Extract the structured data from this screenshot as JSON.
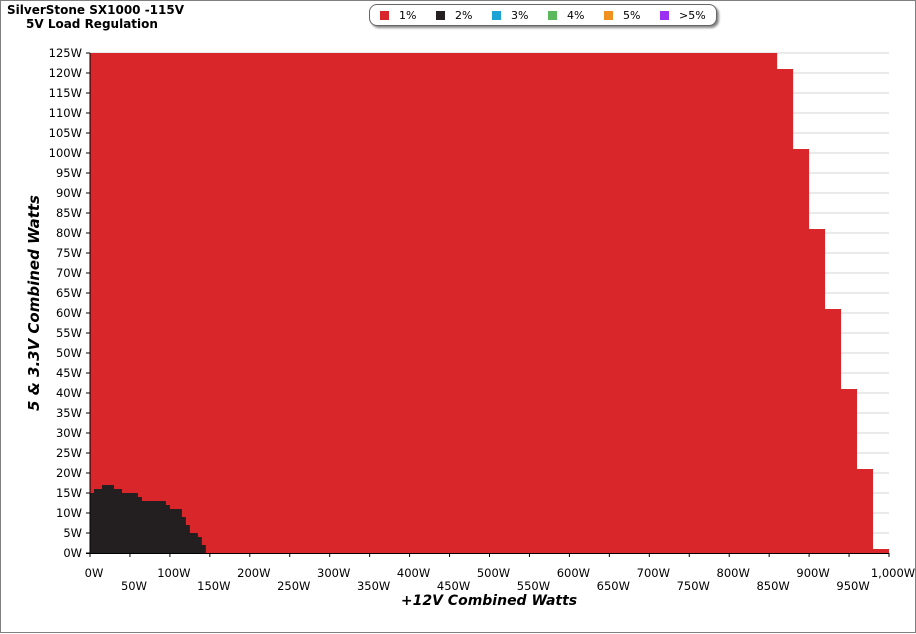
{
  "header": {
    "title": "SilverStone SX1000 -115V",
    "subtitle": "5V Load Regulation"
  },
  "legend": [
    {
      "label": "1%",
      "color": "#d9262b"
    },
    {
      "label": "2%",
      "color": "#231f20"
    },
    {
      "label": "3%",
      "color": "#1aa3d4"
    },
    {
      "label": "4%",
      "color": "#5cb85c"
    },
    {
      "label": "5%",
      "color": "#f0901e"
    },
    {
      "label": ">5%",
      "color": "#9b30f2"
    }
  ],
  "chart_data": {
    "type": "area",
    "xlabel": "+12V Combined Watts",
    "ylabel": "5 & 3.3V Combined Watts",
    "xlim": [
      0,
      1000
    ],
    "ylim": [
      0,
      125
    ],
    "x_ticks": [
      "0W",
      "50W",
      "100W",
      "150W",
      "200W",
      "250W",
      "300W",
      "350W",
      "400W",
      "450W",
      "500W",
      "550W",
      "600W",
      "650W",
      "700W",
      "750W",
      "800W",
      "850W",
      "900W",
      "950W",
      "1,000W"
    ],
    "y_ticks": [
      "0W",
      "5W",
      "10W",
      "15W",
      "20W",
      "25W",
      "30W",
      "35W",
      "40W",
      "45W",
      "50W",
      "55W",
      "60W",
      "65W",
      "70W",
      "75W",
      "80W",
      "85W",
      "90W",
      "95W",
      "100W",
      "105W",
      "110W",
      "115W",
      "120W",
      "125W"
    ],
    "grid": true,
    "series": [
      {
        "name": "1%",
        "color": "#d9262b",
        "x_edges": [
          0,
          860,
          880,
          900,
          920,
          940,
          960,
          980,
          1000
        ],
        "y_max": [
          125,
          121,
          101,
          81,
          61,
          41,
          21,
          1
        ]
      },
      {
        "name": "2%",
        "color": "#231f20",
        "x_edges": [
          0,
          5,
          10,
          15,
          30,
          35,
          40,
          60,
          65,
          75,
          95,
          100,
          115,
          120,
          125,
          135,
          140,
          145
        ],
        "y_max": [
          15,
          16,
          16,
          17,
          16,
          16,
          15,
          14,
          13,
          13,
          12,
          11,
          9,
          7,
          5,
          4,
          2
        ]
      }
    ]
  }
}
